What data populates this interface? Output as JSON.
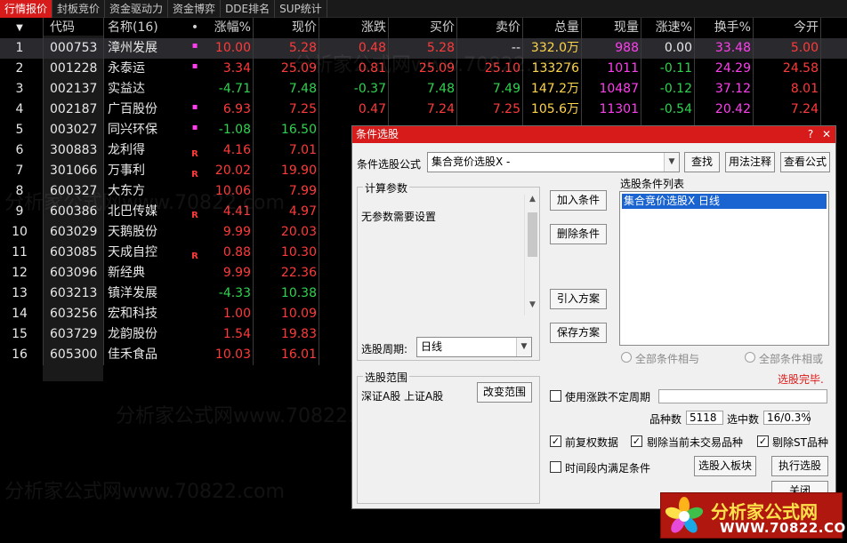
{
  "tabs": [
    "行情报价",
    "封板竞价",
    "资金驱动力",
    "资金博弈",
    "DDE排名",
    "SUP统计"
  ],
  "active_tab": 0,
  "table": {
    "headers": {
      "sort": "▼",
      "code": "代码",
      "name": "名称(16)",
      "mark": "•",
      "zf": "涨幅%",
      "xj": "现价",
      "zd": "涨跌",
      "mr": "买价",
      "mc": "卖价",
      "zl": "总量",
      "xl": "现量",
      "zs": "涨速%",
      "hs": "换手%",
      "jk": "今开"
    },
    "rows": [
      {
        "idx": "1",
        "code": "000753",
        "name": "漳州发展",
        "mark": "dot",
        "zf": "10.00",
        "xj": "5.28",
        "zd": "0.48",
        "mr": "5.28",
        "mc": "--",
        "zl": "332.0万",
        "xl": "988",
        "zs": "0.00",
        "hs": "33.48",
        "jk": "5.00",
        "dir": "up",
        "zs_dir": "flat"
      },
      {
        "idx": "2",
        "code": "001228",
        "name": "永泰运",
        "mark": "dot",
        "zf": "3.34",
        "xj": "25.09",
        "zd": "0.81",
        "mr": "25.09",
        "mc": "25.10",
        "zl": "133276",
        "xl": "1011",
        "zs": "-0.11",
        "hs": "24.29",
        "jk": "24.58",
        "dir": "up",
        "zs_dir": "down"
      },
      {
        "idx": "3",
        "code": "002137",
        "name": "实益达",
        "mark": "",
        "zf": "-4.71",
        "xj": "7.48",
        "zd": "-0.37",
        "mr": "7.48",
        "mc": "7.49",
        "zl": "147.2万",
        "xl": "10487",
        "zs": "-0.12",
        "hs": "37.12",
        "jk": "8.01",
        "dir": "down",
        "zs_dir": "down"
      },
      {
        "idx": "4",
        "code": "002187",
        "name": "广百股份",
        "mark": "dot",
        "zf": "6.93",
        "xj": "7.25",
        "zd": "0.47",
        "mr": "7.24",
        "mc": "7.25",
        "zl": "105.6万",
        "xl": "11301",
        "zs": "-0.54",
        "hs": "20.42",
        "jk": "7.24",
        "dir": "up",
        "zs_dir": "down"
      },
      {
        "idx": "5",
        "code": "003027",
        "name": "同兴环保",
        "mark": "dot",
        "zf": "-1.08",
        "xj": "16.50",
        "zd": "",
        "mr": "",
        "mc": "",
        "zl": "",
        "xl": "",
        "zs": "",
        "hs": "",
        "jk": "",
        "dir": "down",
        "zs_dir": "flat"
      },
      {
        "idx": "6",
        "code": "300883",
        "name": "龙利得",
        "mark": "R",
        "zf": "4.16",
        "xj": "7.01",
        "zd": "",
        "mr": "",
        "mc": "",
        "zl": "",
        "xl": "",
        "zs": "",
        "hs": "",
        "jk": "",
        "dir": "up",
        "zs_dir": "flat"
      },
      {
        "idx": "7",
        "code": "301066",
        "name": "万事利",
        "mark": "R",
        "zf": "20.02",
        "xj": "19.90",
        "zd": "",
        "mr": "",
        "mc": "",
        "zl": "",
        "xl": "",
        "zs": "",
        "hs": "",
        "jk": "",
        "dir": "up",
        "zs_dir": "flat"
      },
      {
        "idx": "8",
        "code": "600327",
        "name": "大东方",
        "mark": "",
        "zf": "10.06",
        "xj": "7.99",
        "zd": "",
        "mr": "",
        "mc": "",
        "zl": "",
        "xl": "",
        "zs": "",
        "hs": "",
        "jk": "",
        "dir": "up",
        "zs_dir": "flat"
      },
      {
        "idx": "9",
        "code": "600386",
        "name": "北巴传媒",
        "mark": "R",
        "zf": "4.41",
        "xj": "4.97",
        "zd": "",
        "mr": "",
        "mc": "",
        "zl": "",
        "xl": "",
        "zs": "",
        "hs": "",
        "jk": "",
        "dir": "up",
        "zs_dir": "flat"
      },
      {
        "idx": "10",
        "code": "603029",
        "name": "天鹅股份",
        "mark": "",
        "zf": "9.99",
        "xj": "20.03",
        "zd": "",
        "mr": "",
        "mc": "",
        "zl": "",
        "xl": "",
        "zs": "",
        "hs": "",
        "jk": "",
        "dir": "up",
        "zs_dir": "flat"
      },
      {
        "idx": "11",
        "code": "603085",
        "name": "天成自控",
        "mark": "R",
        "zf": "0.88",
        "xj": "10.30",
        "zd": "",
        "mr": "",
        "mc": "",
        "zl": "",
        "xl": "",
        "zs": "",
        "hs": "",
        "jk": "",
        "dir": "up",
        "zs_dir": "flat"
      },
      {
        "idx": "12",
        "code": "603096",
        "name": "新经典",
        "mark": "",
        "zf": "9.99",
        "xj": "22.36",
        "zd": "",
        "mr": "",
        "mc": "",
        "zl": "",
        "xl": "",
        "zs": "",
        "hs": "",
        "jk": "",
        "dir": "up",
        "zs_dir": "flat"
      },
      {
        "idx": "13",
        "code": "603213",
        "name": "镇洋发展",
        "mark": "",
        "zf": "-4.33",
        "xj": "10.38",
        "zd": "",
        "mr": "",
        "mc": "",
        "zl": "",
        "xl": "",
        "zs": "",
        "hs": "",
        "jk": "",
        "dir": "down",
        "zs_dir": "flat"
      },
      {
        "idx": "14",
        "code": "603256",
        "name": "宏和科技",
        "mark": "",
        "zf": "1.00",
        "xj": "10.09",
        "zd": "",
        "mr": "",
        "mc": "",
        "zl": "",
        "xl": "",
        "zs": "",
        "hs": "",
        "jk": "",
        "dir": "up",
        "zs_dir": "flat"
      },
      {
        "idx": "15",
        "code": "603729",
        "name": "龙韵股份",
        "mark": "",
        "zf": "1.54",
        "xj": "19.83",
        "zd": "",
        "mr": "",
        "mc": "",
        "zl": "",
        "xl": "",
        "zs": "",
        "hs": "",
        "jk": "",
        "dir": "up",
        "zs_dir": "flat"
      },
      {
        "idx": "16",
        "code": "605300",
        "name": "佳禾食品",
        "mark": "",
        "zf": "10.03",
        "xj": "16.01",
        "zd": "",
        "mr": "",
        "mc": "",
        "zl": "",
        "xl": "",
        "zs": "",
        "hs": "",
        "jk": "",
        "dir": "up",
        "zs_dir": "flat"
      }
    ]
  },
  "watermark_text": "分析家公式网www.70822.com",
  "dialog": {
    "title": "条件选股",
    "help_icon": "?",
    "close_icon": "✕",
    "formula_label": "条件选股公式",
    "formula_value": "集合竞价选股X  -",
    "find_button": "查找",
    "usage_button": "用法注释",
    "view_formula_button": "查看公式",
    "params_group": "计算参数",
    "params_text": "无参数需要设置",
    "add_condition": "加入条件",
    "delete_condition": "删除条件",
    "import_plan": "引入方案",
    "save_plan": "保存方案",
    "conditions_list_label": "选股条件列表",
    "conditions": [
      "集合竞价选股X  日线"
    ],
    "period_label": "选股周期:",
    "period_value": "日线",
    "radio_all_and": "全部条件相与",
    "radio_all_or": "全部条件相或",
    "status": "选股完毕.",
    "range_group": "选股范围",
    "range_text": "深证A股 上证A股",
    "change_range": "改变范围",
    "use_range_label": "使用涨跌不定周期",
    "count_label": "品种数",
    "count_value": "5118",
    "selected_label": "选中数",
    "selected_value": "16/0.3%",
    "chk_fq": "前复权数据",
    "chk_exclude_untraded": "剔除当前未交易品种",
    "chk_exclude_st": "剔除ST品种",
    "chk_time_range": "时间段内满足条件",
    "to_block_button": "选股入板块",
    "run_button": "执行选股",
    "close_button": "关闭"
  },
  "logo": {
    "line1": "分析家公式网",
    "line2": "WWW.70822.COM"
  },
  "colors": {
    "up": "#ff3a3a",
    "down": "#2fd34f",
    "volume": "#ffd54a",
    "turnover": "#ff3ef0",
    "accent": "#d71a1a"
  }
}
